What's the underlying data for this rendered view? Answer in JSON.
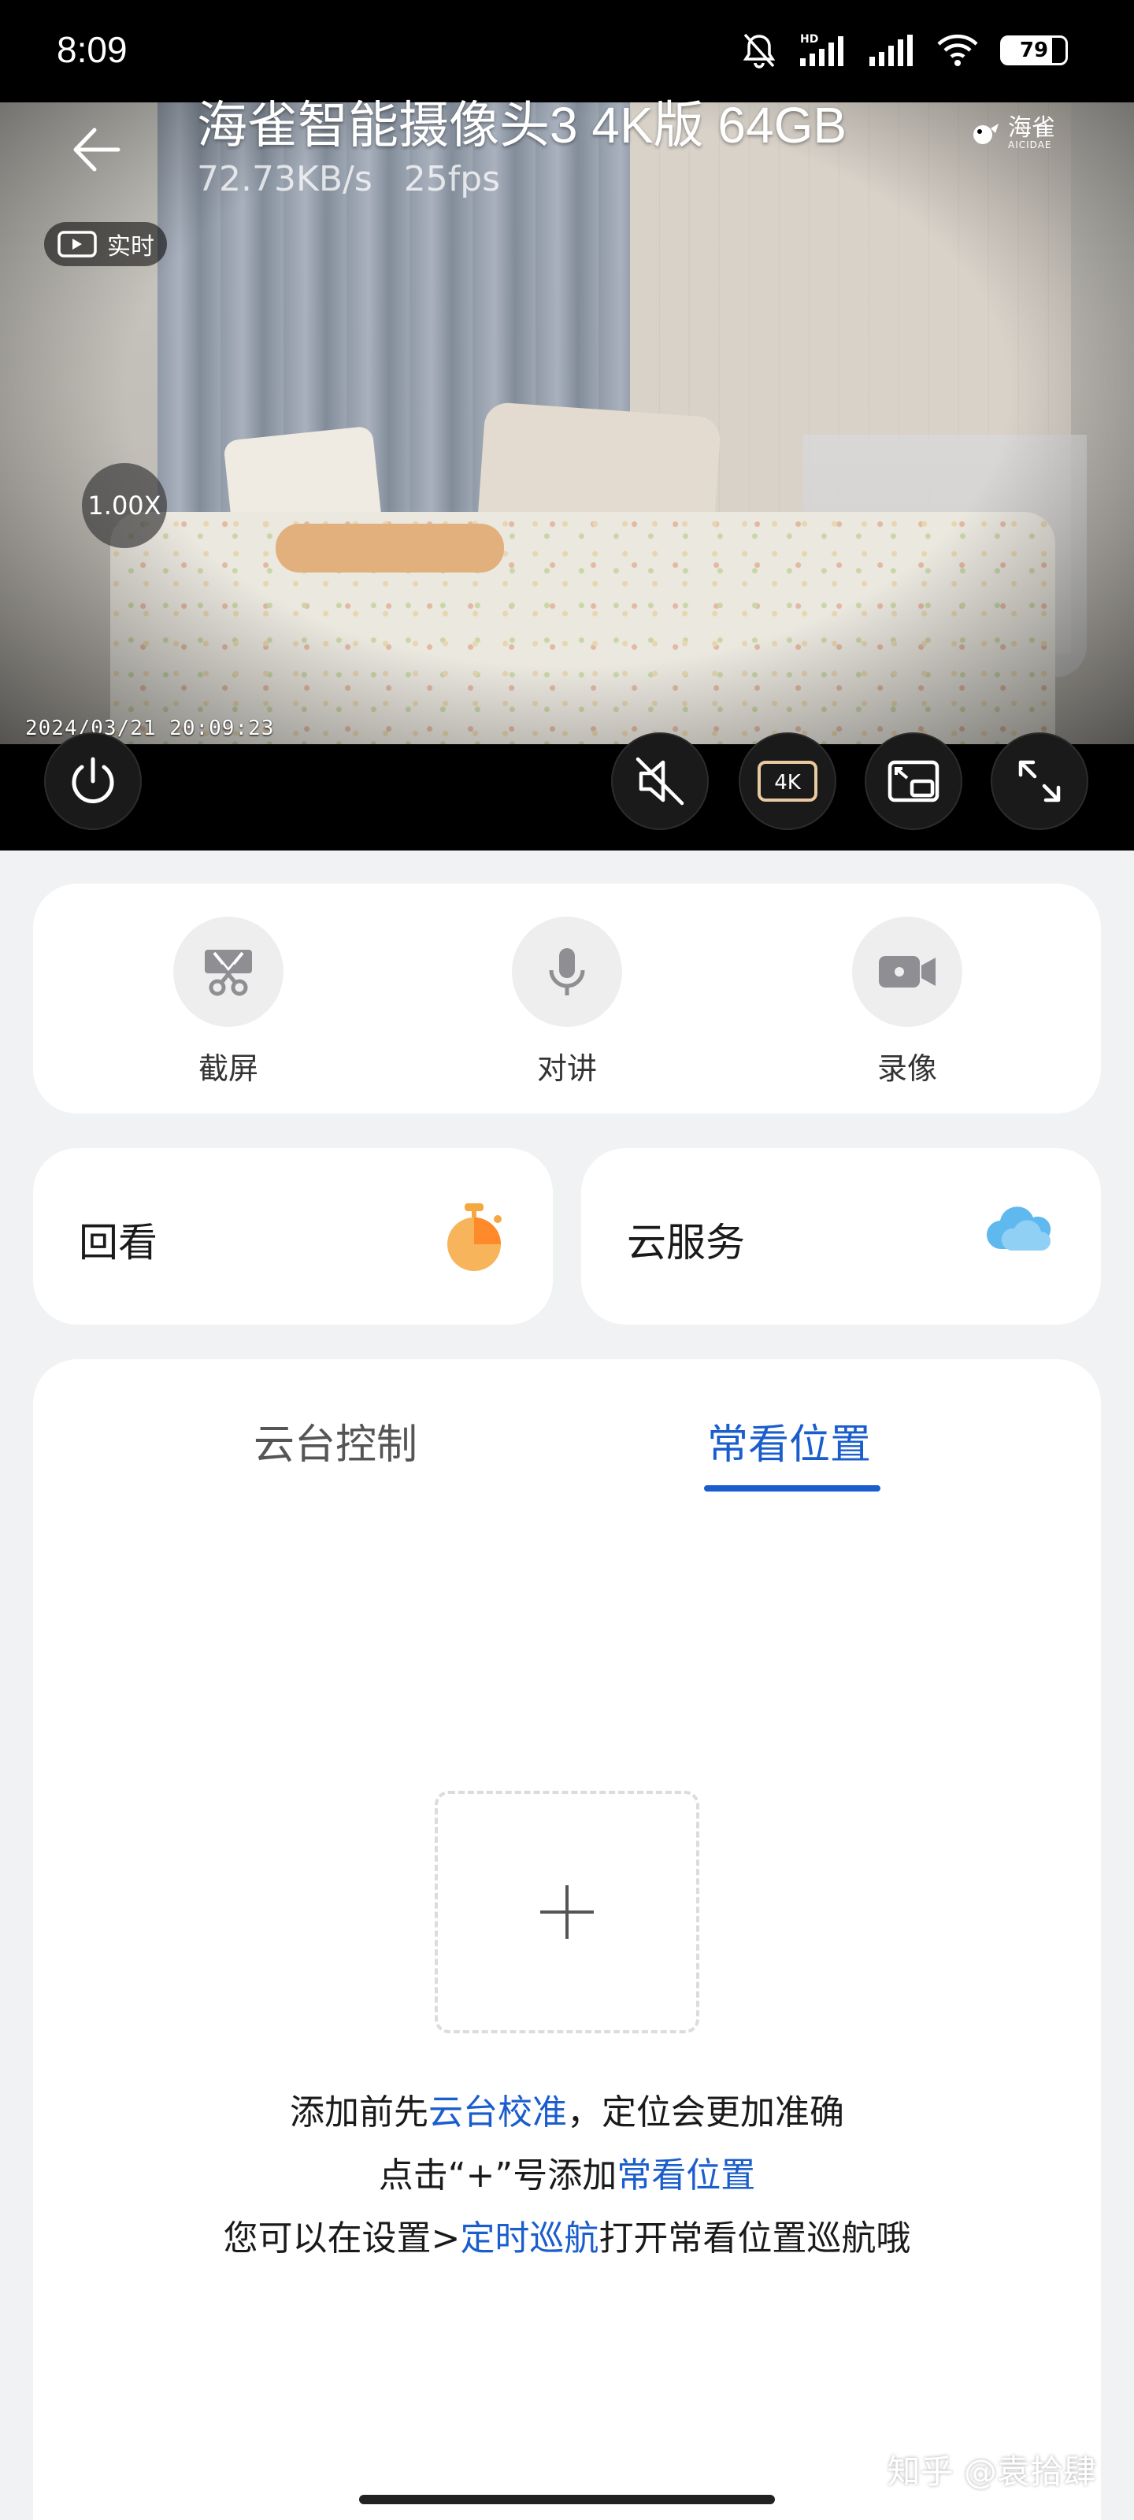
{
  "status_bar": {
    "time": "8:09",
    "battery": "79",
    "network_tag": "HD"
  },
  "camera": {
    "title": "海雀智能摄像头3 4K版 64GB",
    "bitrate": "72.73KB/s",
    "fps": "25fps",
    "brand": "海雀",
    "brand_sub": "AICIDAE",
    "live_label": "实时",
    "zoom": "1.00X",
    "timestamp": "2024/03/21  20:09:23",
    "quality_label": "4K"
  },
  "actions": [
    {
      "label": "截屏",
      "icon": "scissors-icon"
    },
    {
      "label": "对讲",
      "icon": "microphone-icon"
    },
    {
      "label": "录像",
      "icon": "video-camera-icon"
    }
  ],
  "quick": {
    "playback": "回看",
    "cloud": "云服务"
  },
  "tabs": {
    "ptz": "云台控制",
    "presets": "常看位置",
    "active": "常看位置"
  },
  "hint": {
    "line1_a": "添加前先",
    "line1_link": "云台校准",
    "line1_b": "，定位会更加准确",
    "line2_a": "点击“+”号添加",
    "line2_link": "常看位置",
    "line3_a": "您可以在设置>",
    "line3_link": "定时巡航",
    "line3_b": "打开常看位置巡航哦"
  },
  "watermark": "知乎 @袁拾肆",
  "colors": {
    "accent": "#1a5dcc",
    "orange": "#f5a742",
    "cloud": "#5fb8ee"
  }
}
